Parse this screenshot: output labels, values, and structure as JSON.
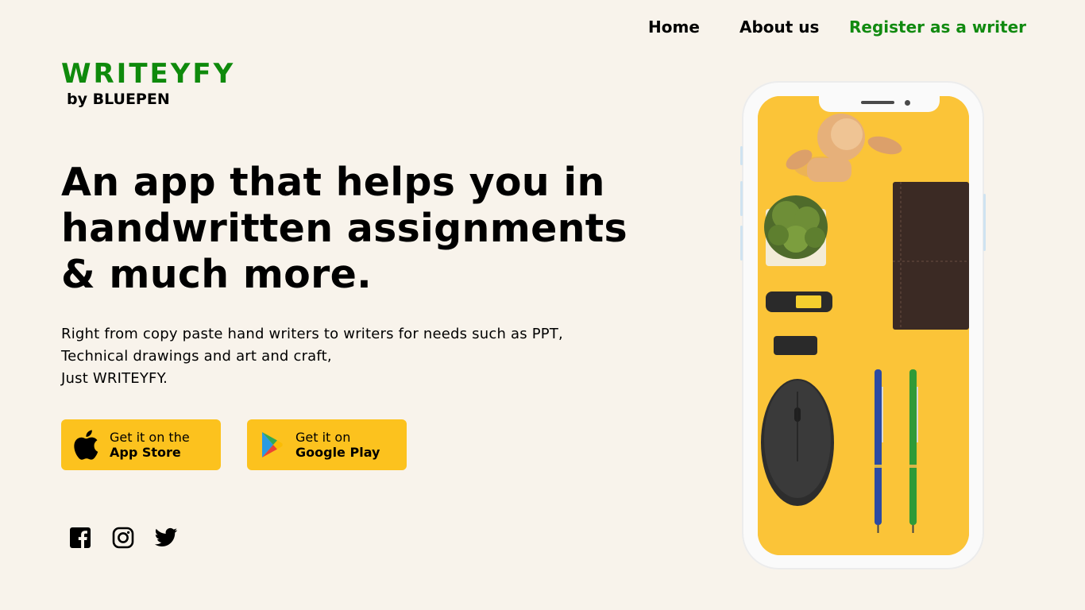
{
  "nav": {
    "home": "Home",
    "about": "About us",
    "register": "Register as a writer"
  },
  "brand": {
    "title": "WRITEYFY",
    "subtitle": "by BLUEPEN"
  },
  "hero": {
    "headline_lines": [
      "An app that helps you in",
      "handwritten assignments",
      "& much more."
    ],
    "description_lines": [
      "Right from copy paste hand writers to writers for needs such as PPT,",
      "Technical drawings and art and craft,",
      "Just WRITEYFY."
    ]
  },
  "stores": {
    "apple": {
      "line1": "Get it on the",
      "line2": "App Store",
      "icon": "apple-icon"
    },
    "google": {
      "line1": "Get it on",
      "line2": "Google Play",
      "icon": "google-play-icon"
    }
  },
  "social": [
    "facebook-icon",
    "instagram-icon",
    "twitter-icon"
  ],
  "colors": {
    "background": "#f8f3eb",
    "brand_green": "#0f8a0c",
    "button_yellow": "#fcc21e",
    "screen_yellow": "#fbc438"
  }
}
